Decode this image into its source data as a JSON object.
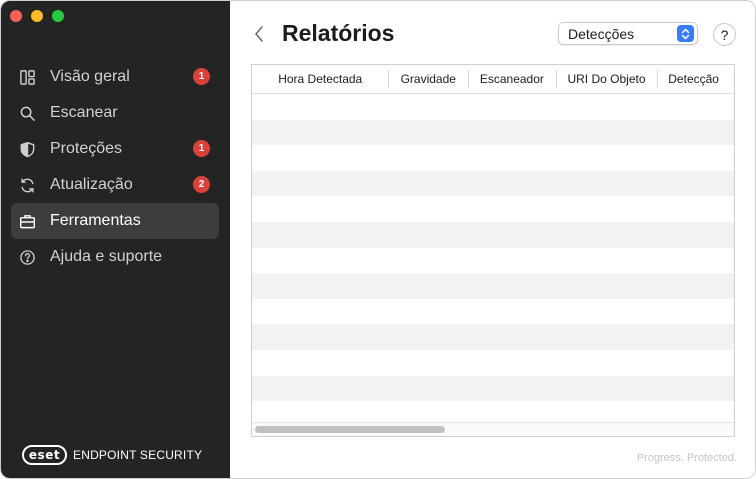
{
  "sidebar": {
    "items": [
      {
        "label": "Visão geral",
        "icon": "dashboard-icon",
        "badge": "1",
        "active": false
      },
      {
        "label": "Escanear",
        "icon": "search-icon",
        "badge": "",
        "active": false
      },
      {
        "label": "Proteções",
        "icon": "shield-icon",
        "badge": "1",
        "active": false
      },
      {
        "label": "Atualização",
        "icon": "refresh-icon",
        "badge": "2",
        "active": false
      },
      {
        "label": "Ferramentas",
        "icon": "briefcase-icon",
        "badge": "",
        "active": true
      },
      {
        "label": "Ajuda e suporte",
        "icon": "help-circle-icon",
        "badge": "",
        "active": false
      }
    ],
    "brand_logo": "eset",
    "brand_text": "ENDPOINT SECURITY"
  },
  "main": {
    "title": "Relatórios",
    "log_select": {
      "value": "Detecções"
    },
    "help_label": "?",
    "columns": [
      "Hora Detectada",
      "Gravidade",
      "Escaneador",
      "URI Do Objeto",
      "Detecção"
    ],
    "row_count_visible": 13,
    "tagline": "Progress. Protected."
  },
  "colors": {
    "sidebar_bg": "#242424",
    "active_item_bg": "#3d3d3d",
    "badge_red": "#d8423a",
    "accent_blue": "#3a7cf6",
    "row_stripe": "#f2f2f2"
  }
}
